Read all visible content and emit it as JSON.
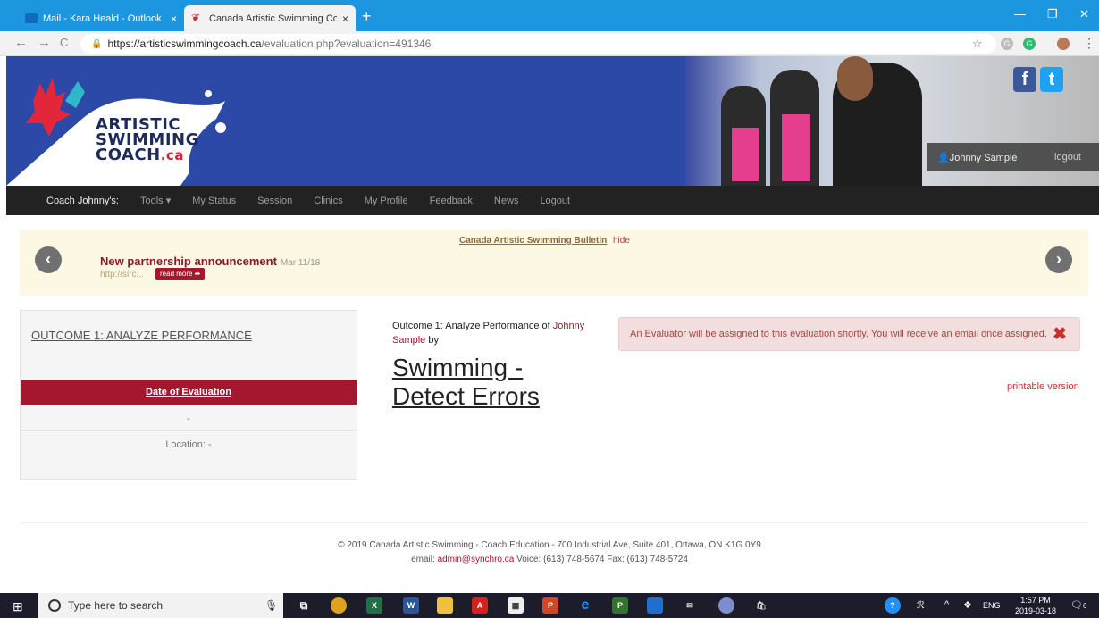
{
  "browser": {
    "tabs": [
      {
        "title": "Mail - Kara Heald - Outlook",
        "close": "×"
      },
      {
        "title": "Canada Artistic Swimming Coach",
        "close": "×"
      }
    ],
    "new_tab": "+",
    "url_host": "https://artisticswimmingcoach.ca",
    "url_path": "/evaluation.php?evaluation=491346"
  },
  "header": {
    "logo_line1": "ARTISTIC",
    "logo_line2": "SWIMMING",
    "logo_line3": "COACH",
    "logo_suffix": ".ca",
    "facebook": "f",
    "twitter": "t",
    "user_name": "Johnny Sample",
    "logout": "logout"
  },
  "nav": {
    "brand": "Coach Johnny's:",
    "items": [
      "Tools ▾",
      "My Status",
      "Session",
      "Clinics",
      "My Profile",
      "Feedback",
      "News",
      "Logout"
    ]
  },
  "bulletin": {
    "title": "Canada Artistic Swimming Bulletin",
    "hide": "hide",
    "news_title": "New partnership announcement",
    "news_date": "Mar 11/18",
    "news_url": "http://sirc...",
    "read_more": "read more ➦"
  },
  "outcome_panel": {
    "title": "OUTCOME 1: ANALYZE PERFORMANCE",
    "date_header": "Date of Evaluation",
    "date_value": "-",
    "location": "Location: -"
  },
  "main": {
    "outcome_prefix": "Outcome 1: Analyze Performance",
    "of": "of",
    "person": "Johnny Sample",
    "by": "by",
    "title_line1": "Swimming -",
    "title_line2": "Detect Errors"
  },
  "alert": {
    "message": "An Evaluator will be assigned to this evaluation shortly. You will receive an email once assigned.",
    "close": "✖",
    "printable": "printable version"
  },
  "footer": {
    "line1": "© 2019 Canada Artistic Swimming - Coach Education - 700 Industrial Ave, Suite 401, Ottawa, ON K1G 0Y9",
    "email_label": "email:",
    "email": "admin@synchro.ca",
    "phones": "Voice: (613) 748-5674 Fax: (613) 748-5724"
  },
  "taskbar": {
    "search_placeholder": "Type here to search",
    "lang": "ENG",
    "time": "1:57 PM",
    "date": "2019-03-18",
    "notifications": "6"
  },
  "colors": {
    "brand_red": "#a4182e",
    "banner_blue": "#2c49a7",
    "chrome_blue": "#1d96e0"
  }
}
